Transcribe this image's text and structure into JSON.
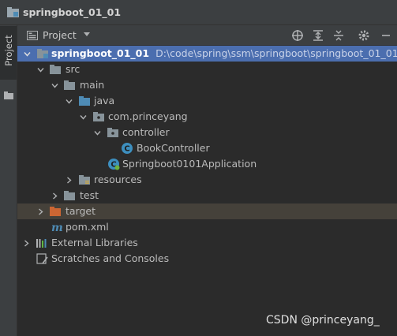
{
  "window": {
    "title": "springboot_01_01"
  },
  "side_strip": {
    "tab_label": "Project"
  },
  "tool_header": {
    "view_label": "Project",
    "buttons": [
      "crosshair-icon",
      "expand-all-icon",
      "collapse-all-icon",
      "gear-icon",
      "minimize-icon"
    ]
  },
  "tree": {
    "root": {
      "name": "springboot_01_01",
      "path": "D:\\code\\spring\\ssm\\springboot\\springboot_01_01"
    },
    "src": "src",
    "main": "main",
    "java": "java",
    "package": "com.princeyang",
    "controller": "controller",
    "book_controller": "BookController",
    "application": "Springboot0101Application",
    "resources": "resources",
    "test": "test",
    "target": "target",
    "pom": "pom.xml",
    "external_libraries": "External Libraries",
    "scratches": "Scratches and Consoles"
  },
  "watermark": "CSDN @princeyang_",
  "colors": {
    "selection": "#4b6eaf",
    "target_highlight": "#45413a",
    "folder": "#87939a",
    "source_folder": "#4e8bb5",
    "excluded_folder": "#cc6633",
    "class_icon": "#3d8fbf"
  }
}
